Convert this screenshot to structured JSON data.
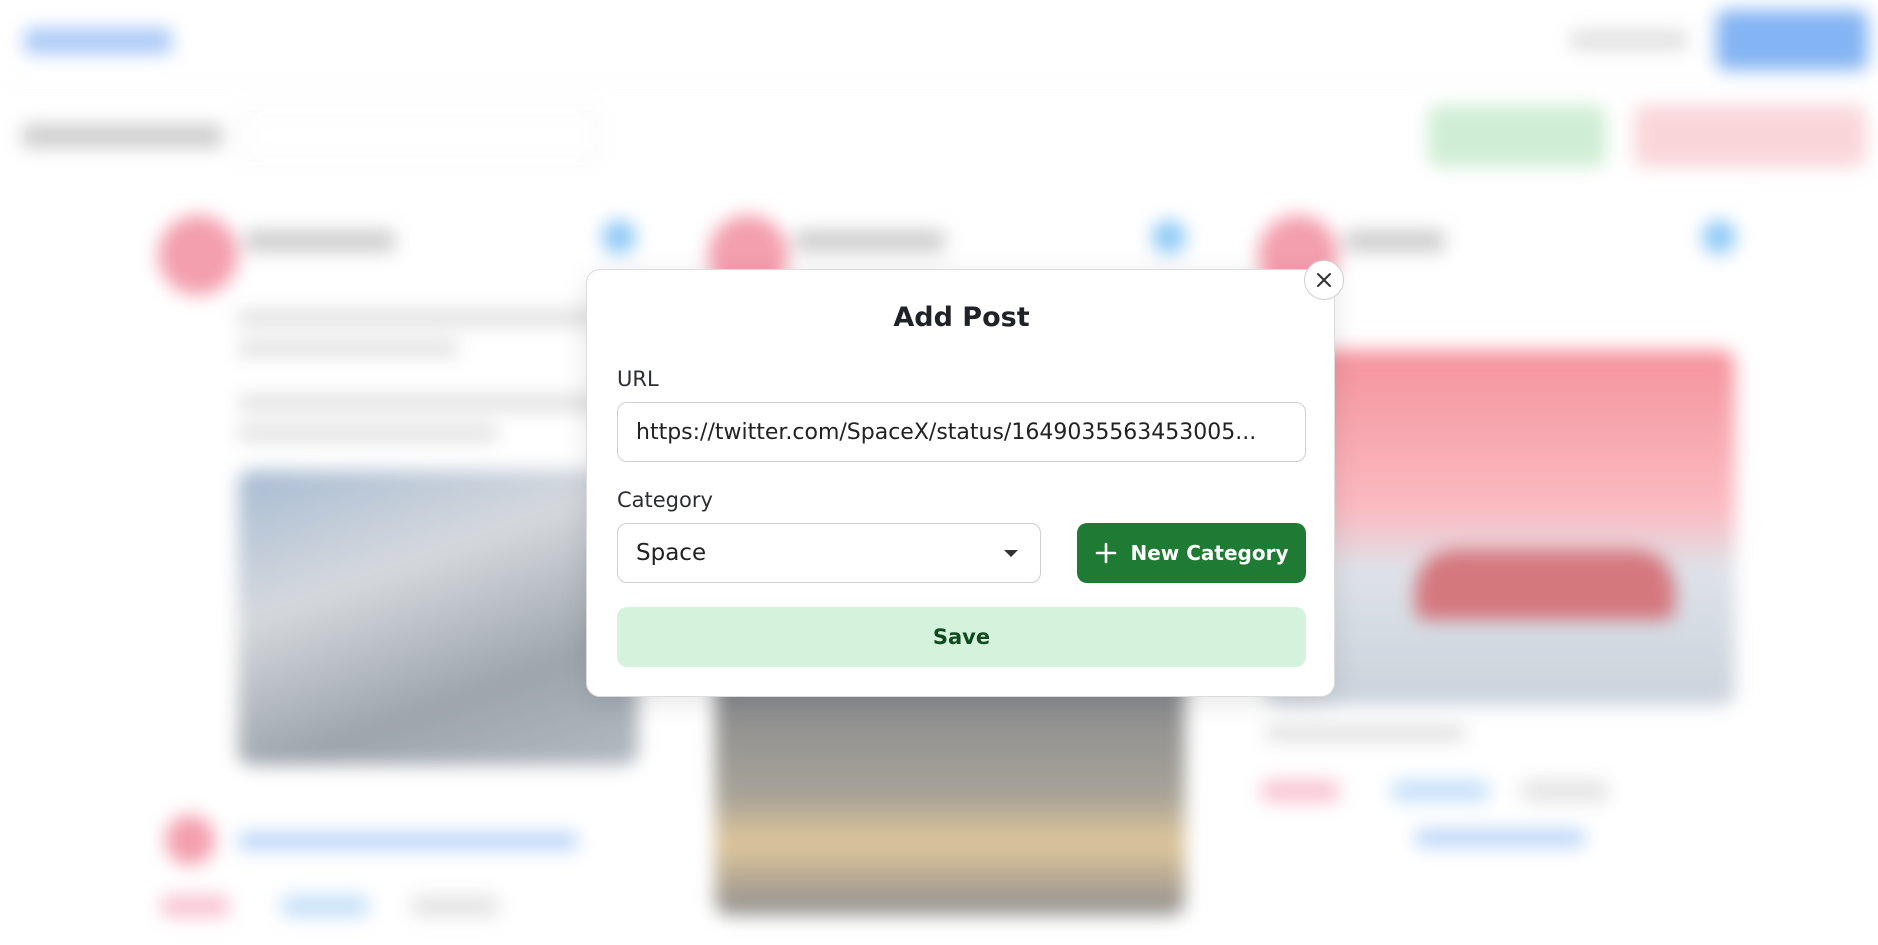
{
  "modal": {
    "title": "Add Post",
    "url_label": "URL",
    "url_value": "https://twitter.com/SpaceX/status/1649035563453005...",
    "category_label": "Category",
    "category_value": "Space",
    "new_category_label": "New Category",
    "save_label": "Save",
    "close_icon": "close-icon",
    "plus_icon": "plus-icon",
    "caret_icon": "chevron-down-icon"
  },
  "colors": {
    "primary_green": "#1f7a34",
    "save_bg": "#d5f3dc",
    "save_text": "#114a20",
    "overlay_blue": "#5b9bef",
    "overlay_red": "#f8c8cd"
  }
}
